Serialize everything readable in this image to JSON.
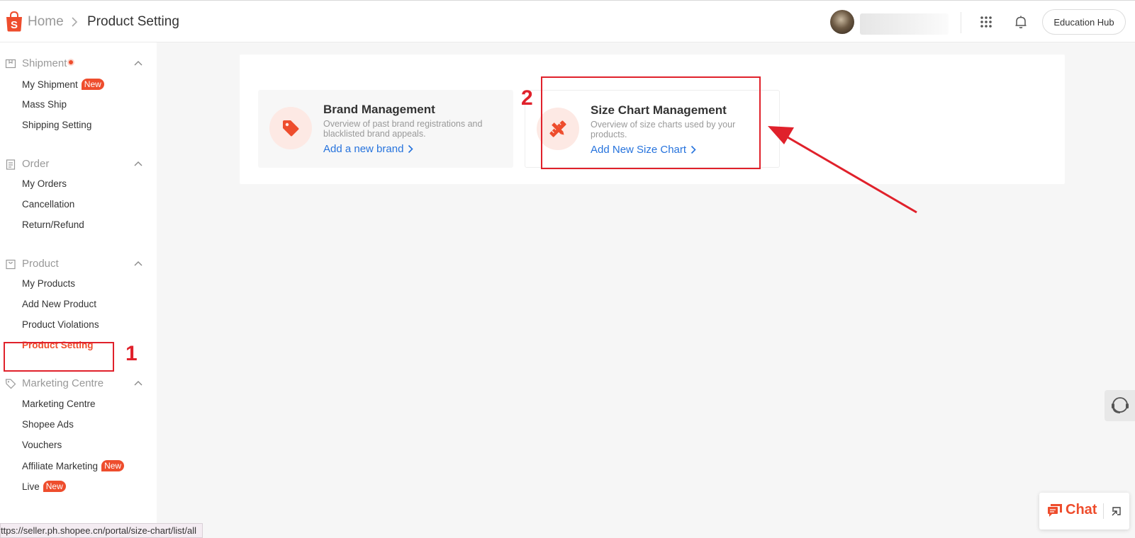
{
  "breadcrumb": {
    "home": "Home",
    "current": "Product Setting"
  },
  "header": {
    "education_hub": "Education Hub"
  },
  "sidebar": {
    "sections": [
      {
        "title": "Shipment",
        "items": [
          {
            "label": "My Shipment",
            "badge": "New"
          },
          {
            "label": "Mass Ship"
          },
          {
            "label": "Shipping Setting"
          }
        ]
      },
      {
        "title": "Order",
        "items": [
          {
            "label": "My Orders"
          },
          {
            "label": "Cancellation"
          },
          {
            "label": "Return/Refund"
          }
        ]
      },
      {
        "title": "Product",
        "items": [
          {
            "label": "My Products"
          },
          {
            "label": "Add New Product"
          },
          {
            "label": "Product Violations"
          },
          {
            "label": "Product Setting"
          }
        ]
      },
      {
        "title": "Marketing Centre",
        "items": [
          {
            "label": "Marketing Centre"
          },
          {
            "label": "Shopee Ads"
          },
          {
            "label": "Vouchers"
          },
          {
            "label": "Affiliate Marketing",
            "badge": "New"
          },
          {
            "label": "Live",
            "badge": "New"
          }
        ]
      }
    ]
  },
  "cards": [
    {
      "title": "Brand Management",
      "desc": "Overview of past brand registrations and blacklisted brand appeals.",
      "link": "Add a new brand"
    },
    {
      "title": "Size Chart Management",
      "desc": "Overview of size charts used by your products.",
      "link": "Add New Size Chart"
    }
  ],
  "annotations": {
    "one": "1",
    "two": "2"
  },
  "chat": {
    "label": "Chat"
  },
  "status_url": "ttps://seller.ph.shopee.cn/portal/size-chart/list/all",
  "colors": {
    "brand": "#ee4d2d",
    "link": "#2673dd",
    "annotation": "#e0212b"
  }
}
